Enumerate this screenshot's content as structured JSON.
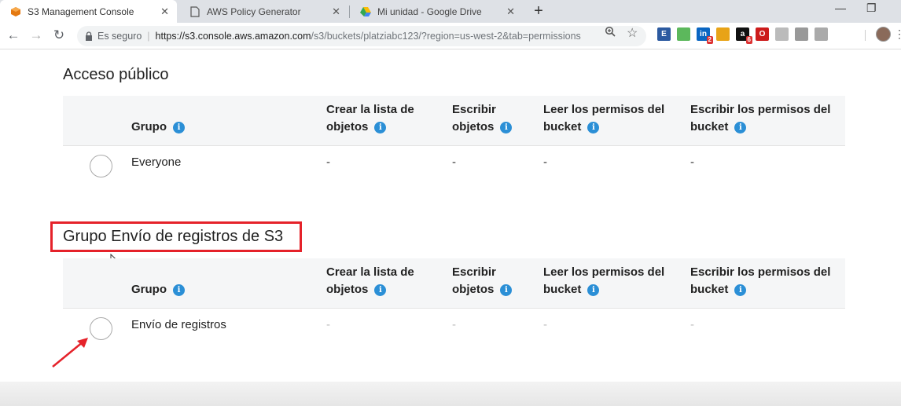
{
  "browser": {
    "tabs": [
      {
        "title": "S3 Management Console",
        "icon": "aws-icon",
        "active": true
      },
      {
        "title": "AWS Policy Generator",
        "icon": "document-icon",
        "active": false
      },
      {
        "title": "Mi unidad - Google Drive",
        "icon": "google-drive-icon",
        "active": false
      }
    ],
    "newtab_label": "+",
    "address": {
      "secure_label": "Es seguro",
      "separator": "|",
      "host": "https://s3.console.aws.amazon.com",
      "path": "/s3/buckets/platziabc123/?region=us-west-2&tab=permissions"
    },
    "extensions": [
      {
        "name": "ext-blue-square-icon",
        "color": "#2c5aa0",
        "text": "E",
        "badge": ""
      },
      {
        "name": "ext-green-tray-icon",
        "color": "#5cb85c",
        "text": "",
        "badge": ""
      },
      {
        "name": "linkedin-icon",
        "color": "#0a66c2",
        "text": "in",
        "badge": "2"
      },
      {
        "name": "ext-triangle-icon",
        "color": "#e8a317",
        "text": "",
        "badge": ""
      },
      {
        "name": "amazon-icon",
        "color": "#111111",
        "text": "a",
        "badge": "6"
      },
      {
        "name": "opera-icon",
        "color": "#cc1b1b",
        "text": "O",
        "badge": ""
      },
      {
        "name": "ext-page-icon",
        "color": "#bbbbbb",
        "text": "",
        "badge": ""
      },
      {
        "name": "ext-cloud-icon",
        "color": "#999999",
        "text": "",
        "badge": ""
      },
      {
        "name": "ext-circle-icon",
        "color": "#aaaaaa",
        "text": "",
        "badge": ""
      }
    ]
  },
  "sections": [
    {
      "title": "Acceso público",
      "headers": {
        "grupo": "Grupo",
        "col1_line1": "Crear la lista de",
        "col1_line2": "objetos",
        "col2_line1": "Escribir",
        "col2_line2": "objetos",
        "col3_line1": "Leer los permisos del",
        "col3_line2": "bucket",
        "col4_line1": "Escribir los permisos del",
        "col4_line2": "bucket"
      },
      "row": {
        "name": "Everyone",
        "values": [
          "-",
          "-",
          "-",
          "-"
        ]
      }
    },
    {
      "title": "Grupo Envío de registros de S3",
      "headers": {
        "grupo": "Grupo",
        "col1_line1": "Crear la lista de",
        "col1_line2": "objetos",
        "col2_line1": "Escribir",
        "col2_line2": "objetos",
        "col3_line1": "Leer los permisos del",
        "col3_line2": "bucket",
        "col4_line1": "Escribir los permisos del",
        "col4_line2": "bucket"
      },
      "row": {
        "name": "Envío de registros",
        "values": [
          "-",
          "-",
          "-",
          "-"
        ]
      }
    }
  ],
  "info_glyph": "i",
  "annotation_color": "#e5222a"
}
